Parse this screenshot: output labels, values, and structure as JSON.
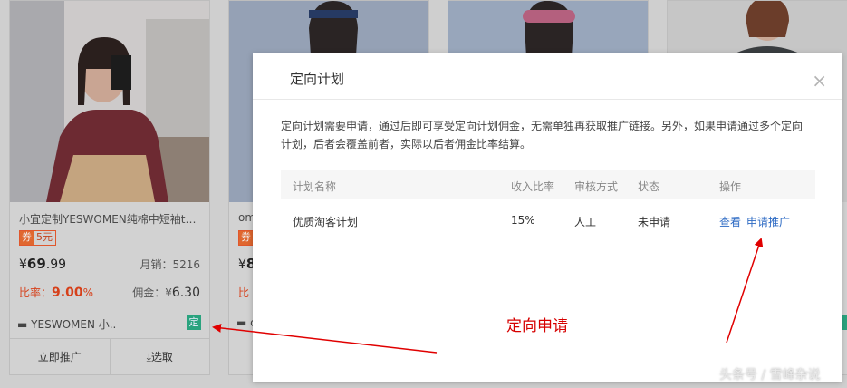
{
  "cards": [
    {
      "title": "小宜定制YESWOMEN纯棉中短袖t…",
      "coupon_tag": "券",
      "coupon_amount": "5元",
      "price_prefix": "¥",
      "price_int": "69",
      "price_dec": ".99",
      "sales": "月销：5216",
      "rate_label": "比率：",
      "rate_value": "9.00",
      "rate_unit": "%",
      "commission_label": "佣金：¥",
      "commission_value": "6.30",
      "shop": "YESWOMEN 小..",
      "targeted_badge": "定",
      "promote_label": "立即推广",
      "select_label": "⤓选取"
    },
    {
      "title": "om",
      "coupon_tag": "券",
      "price_prefix": "¥",
      "price_int": "8",
      "rate_label": "比",
      "shop": "c"
    }
  ],
  "modal": {
    "title": "定向计划",
    "close_glyph": "×",
    "description": "定向计划需要申请，通过后即可享受定向计划佣金，无需单独再获取推广链接。另外，如果申请通过多个定向计划，后者会覆盖前者，实际以后者佣金比率结算。",
    "columns": [
      "计划名称",
      "收入比率",
      "审核方式",
      "状态",
      "操作"
    ],
    "rows": [
      {
        "name": "优质淘客计划",
        "rate": "15%",
        "review": "人工",
        "status": "未申请",
        "view_label": "查看",
        "apply_label": "申请推广"
      }
    ]
  },
  "annotation": {
    "label": "定向申请",
    "color": "#d60000"
  },
  "watermark": "头条号 / 雪峰杂说",
  "colors": {
    "coupon": "#e0572c",
    "rate": "#d6401a",
    "badge": "#2aa37e",
    "link": "#2e6bc4"
  }
}
